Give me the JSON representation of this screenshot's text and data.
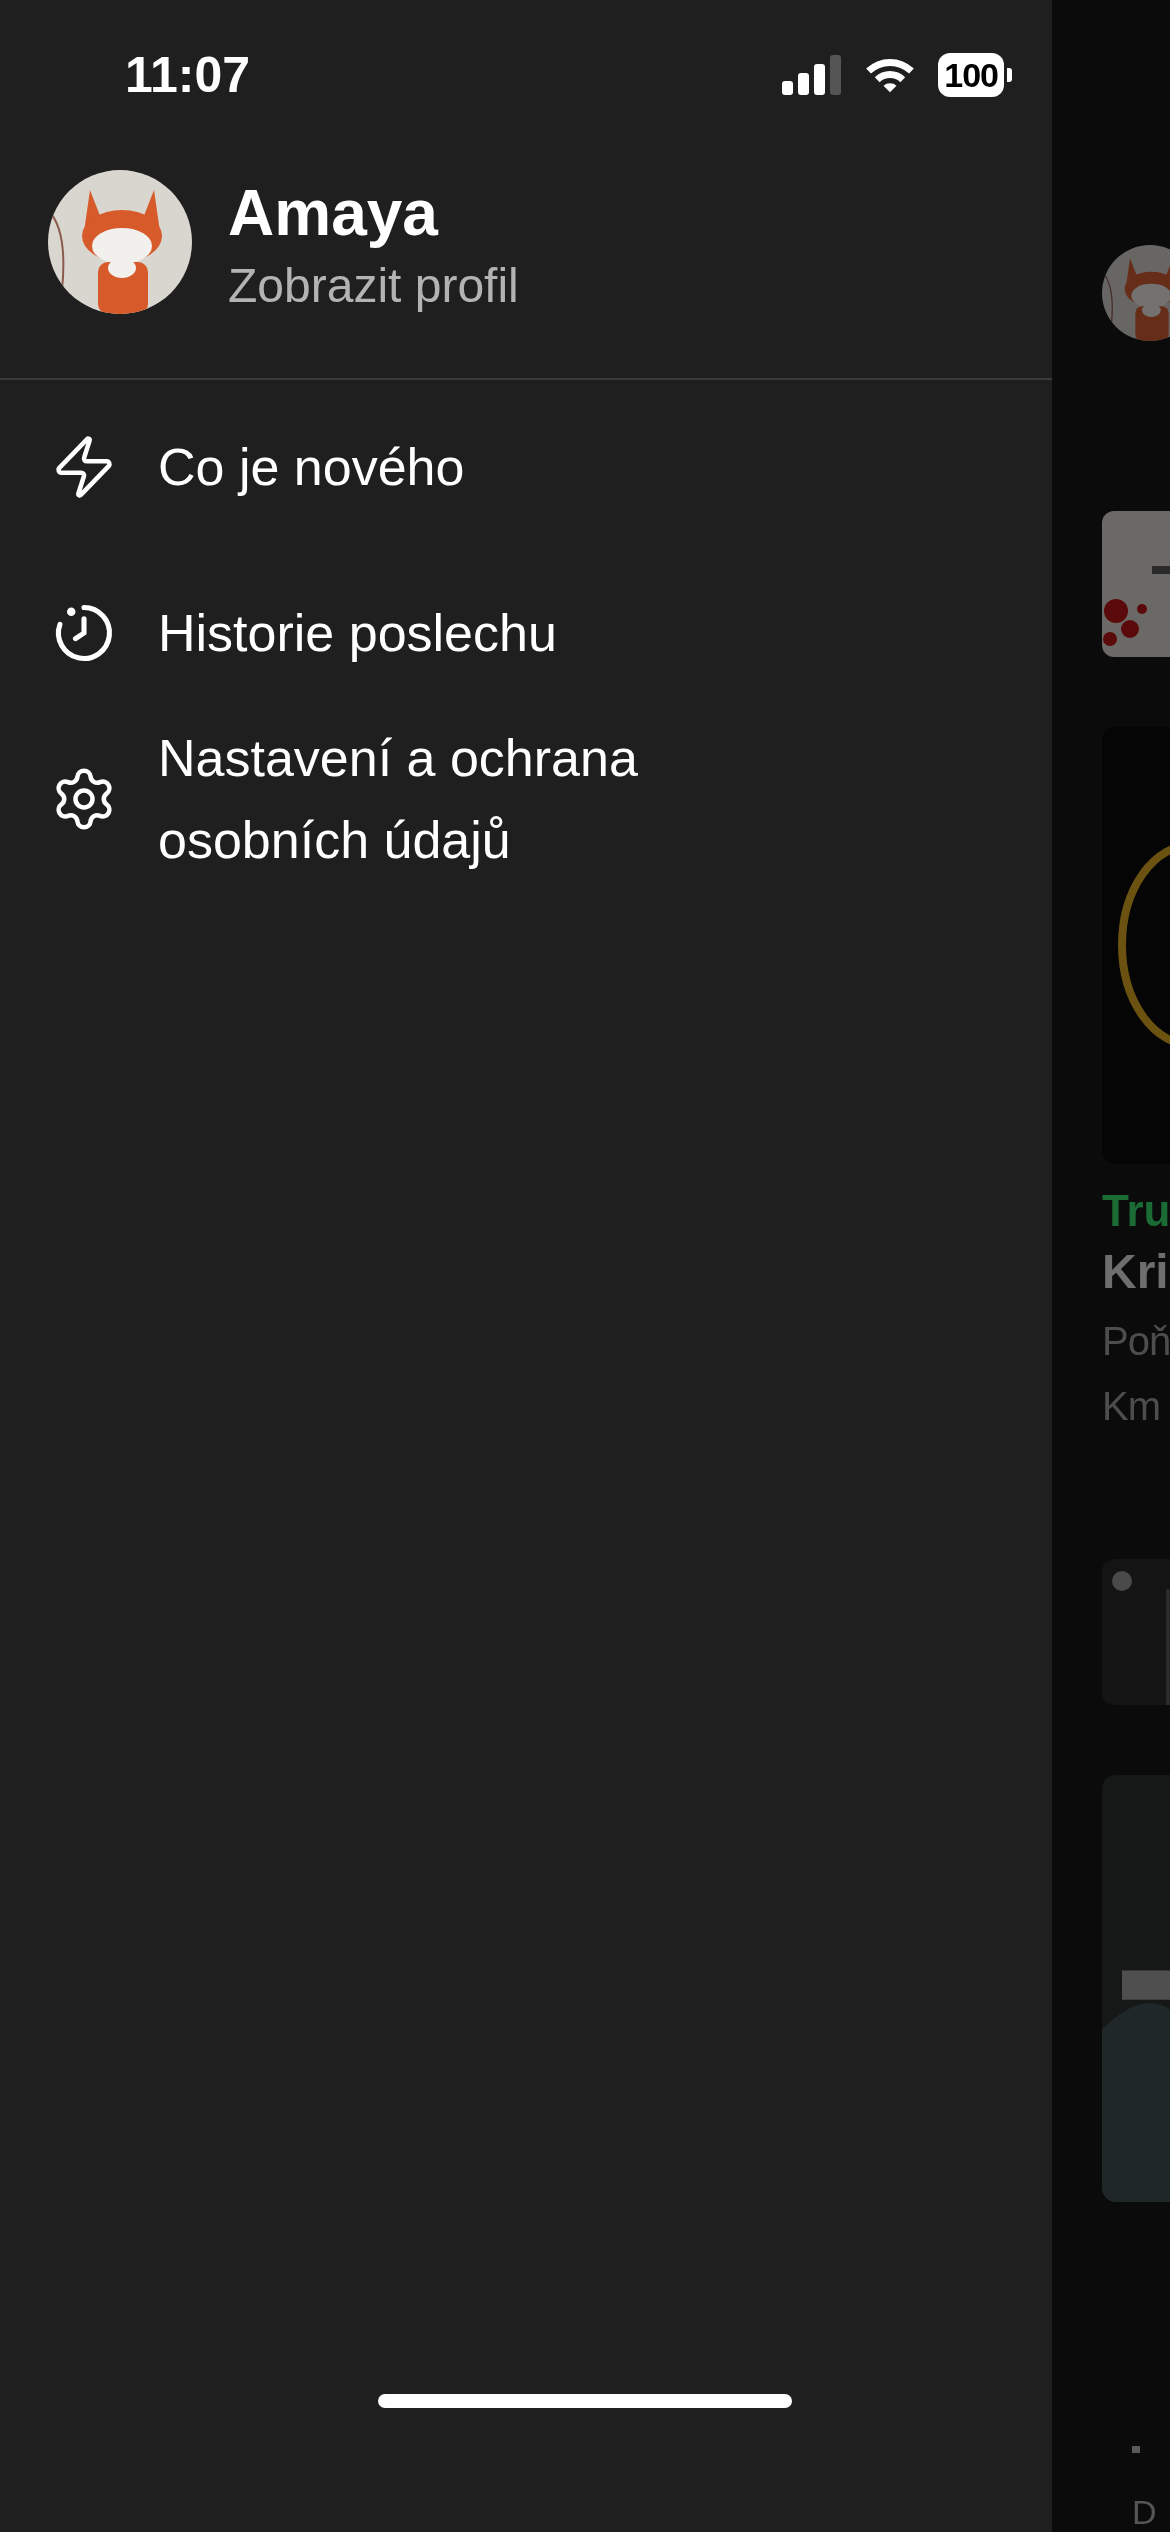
{
  "status_bar": {
    "time": "11:07",
    "battery": "100"
  },
  "profile": {
    "name": "Amaya",
    "link": "Zobrazit profil"
  },
  "menu": [
    {
      "kind": "whats_new",
      "label": "Co je nového"
    },
    {
      "kind": "history",
      "label": "Historie poslechu"
    },
    {
      "kind": "settings",
      "label": "Nastavení a ochrana osobních údajů"
    }
  ],
  "background_page": {
    "episode": {
      "category": "Tru",
      "title": "Kri",
      "line_1": "Poň",
      "line_2": "Km"
    },
    "tab_label": "D"
  }
}
